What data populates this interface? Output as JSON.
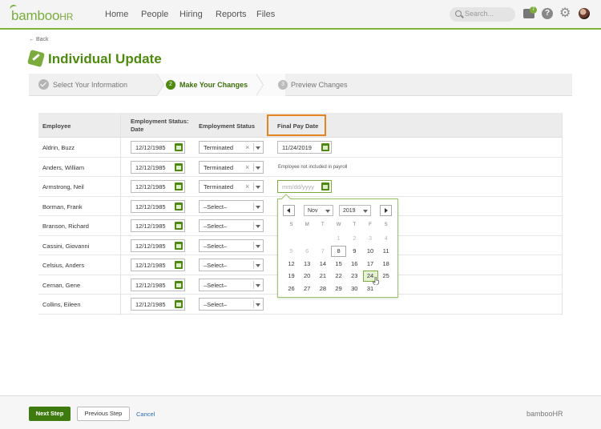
{
  "nav": {
    "logo": "bamboo",
    "logo_suffix": "HR",
    "items": [
      "Home",
      "People",
      "Hiring",
      "Reports",
      "Files"
    ],
    "search_placeholder": "Search...",
    "inbox_count": "7",
    "help_glyph": "?"
  },
  "back_label": "← Back",
  "page_title": "Individual Update",
  "steps": [
    {
      "num": "",
      "label": "Select Your Information",
      "state": "done"
    },
    {
      "num": "2",
      "label": "Make Your Changes",
      "state": "active"
    },
    {
      "num": "3",
      "label": "Preview Changes",
      "state": "pending"
    }
  ],
  "table": {
    "headers": {
      "employee": "Employee",
      "status_date": "Employment Status: Date",
      "status": "Employment Status",
      "final_pay": "Final Pay Date"
    },
    "rows": [
      {
        "name": "Aldrin, Buzz",
        "date": "12/12/1985",
        "status": "Terminated",
        "final_pay": "11/24/2019",
        "note": ""
      },
      {
        "name": "Anders, William",
        "date": "12/12/1985",
        "status": "Terminated",
        "final_pay": "",
        "note": "Employee not included in payroll"
      },
      {
        "name": "Armstrong, Neil",
        "date": "12/12/1985",
        "status": "Terminated",
        "final_pay": "",
        "placeholder": "mm/dd/yyyy",
        "note": ""
      },
      {
        "name": "Borman, Frank",
        "date": "12/12/1985",
        "status": "–Select–",
        "final_pay": "",
        "note": ""
      },
      {
        "name": "Branson, Richard",
        "date": "12/12/1985",
        "status": "–Select–",
        "final_pay": "",
        "note": ""
      },
      {
        "name": "Cassini, Giovanni",
        "date": "12/12/1985",
        "status": "–Select–",
        "final_pay": "",
        "note": ""
      },
      {
        "name": "Celsius, Anders",
        "date": "12/12/1985",
        "status": "–Select–",
        "final_pay": "",
        "note": ""
      },
      {
        "name": "Cernan, Gene",
        "date": "12/12/1985",
        "status": "–Select–",
        "final_pay": "",
        "note": ""
      },
      {
        "name": "Collins, Eileen",
        "date": "12/12/1985",
        "status": "–Select–",
        "final_pay": "",
        "note": ""
      }
    ]
  },
  "datepicker": {
    "month": "Nov",
    "year": "2019",
    "weekdays": [
      "S",
      "M",
      "T",
      "W",
      "T",
      "F",
      "S"
    ],
    "weeks": [
      [
        "",
        "",
        "",
        "1",
        "2",
        "3",
        "4"
      ],
      [
        "5",
        "6",
        "7",
        "8",
        "9",
        "10",
        "11"
      ],
      [
        "12",
        "13",
        "14",
        "15",
        "16",
        "17",
        "18"
      ],
      [
        "19",
        "20",
        "21",
        "22",
        "23",
        "24",
        "25"
      ],
      [
        "26",
        "27",
        "28",
        "29",
        "30",
        "31",
        ""
      ]
    ],
    "today": "8",
    "hovered": "24"
  },
  "footer": {
    "next": "Next Step",
    "prev": "Previous Step",
    "cancel": "Cancel",
    "logo": "bambooHR"
  },
  "colors": {
    "brand_green": "#7aab3c",
    "dark_green": "#3f7a0e",
    "highlight_orange": "#e2851f",
    "link_blue": "#2a6db0"
  }
}
